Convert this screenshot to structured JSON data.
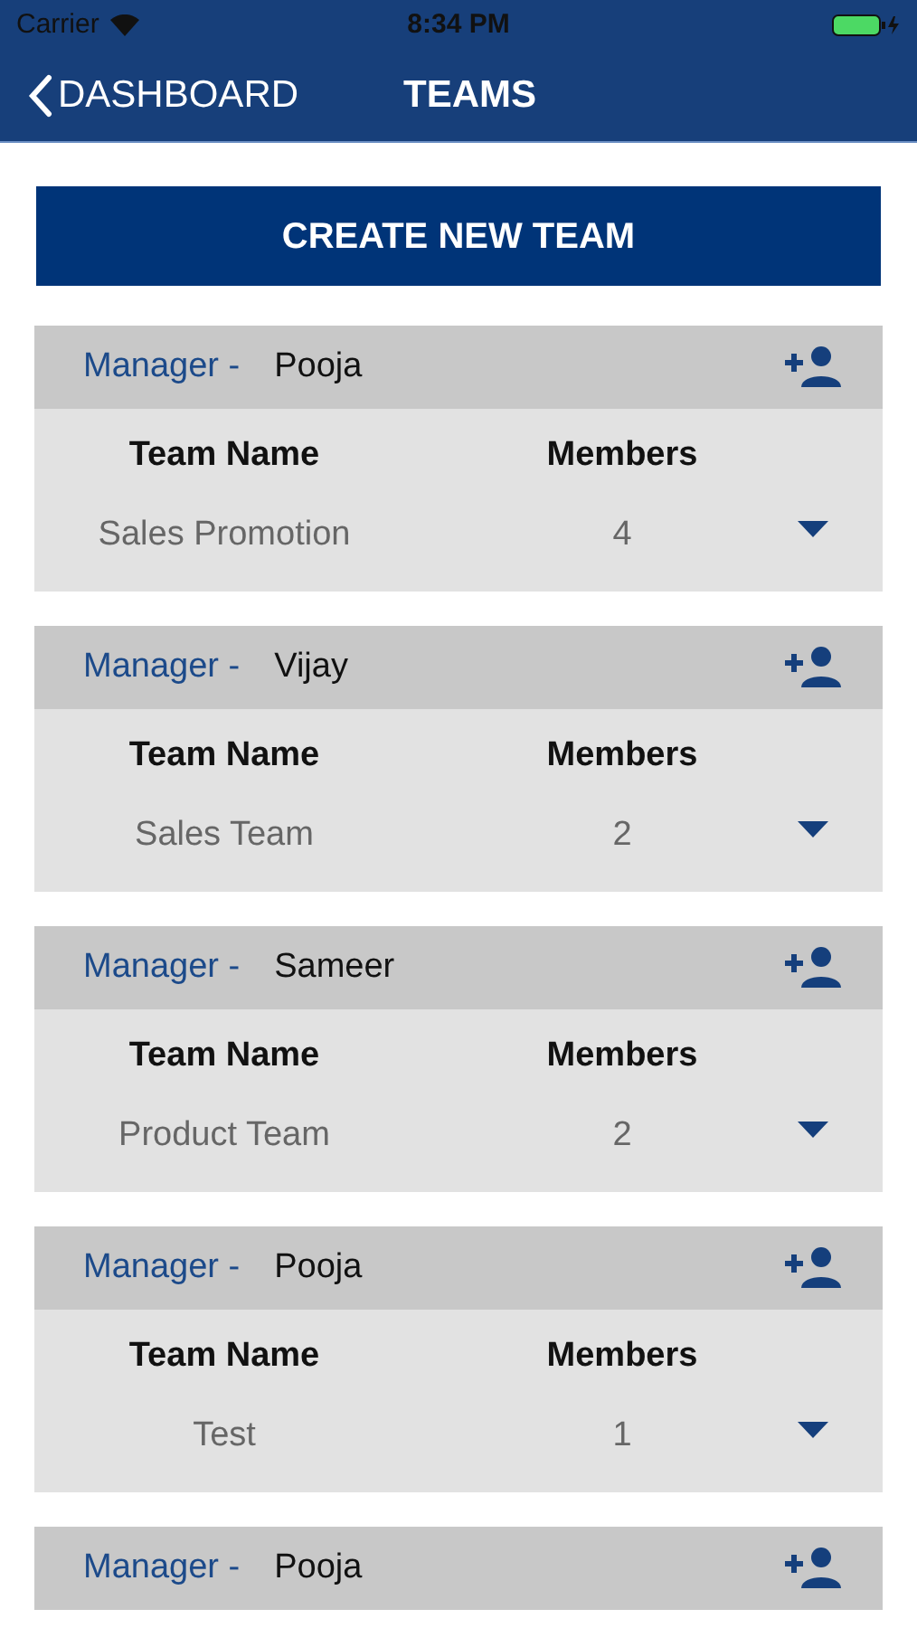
{
  "status_bar": {
    "carrier": "Carrier",
    "time": "8:34 PM"
  },
  "nav": {
    "back": "DASHBOARD",
    "title": "TEAMS"
  },
  "create_button": "CREATE NEW TEAM",
  "teams": [
    {
      "manager_label": "Manager -",
      "manager": "Pooja",
      "name_heading": "Team Name",
      "members_heading": "Members",
      "team_name": "Sales Promotion",
      "members": "4"
    },
    {
      "manager_label": "Manager -",
      "manager": "Vijay",
      "name_heading": "Team Name",
      "members_heading": "Members",
      "team_name": "Sales Team",
      "members": "2"
    },
    {
      "manager_label": "Manager -",
      "manager": "Sameer",
      "name_heading": "Team Name",
      "members_heading": "Members",
      "team_name": "Product Team",
      "members": "2"
    },
    {
      "manager_label": "Manager -",
      "manager": "Pooja",
      "name_heading": "Team Name",
      "members_heading": "Members",
      "team_name": "Test",
      "members": "1"
    },
    {
      "manager_label": "Manager -",
      "manager": "Pooja"
    }
  ]
}
